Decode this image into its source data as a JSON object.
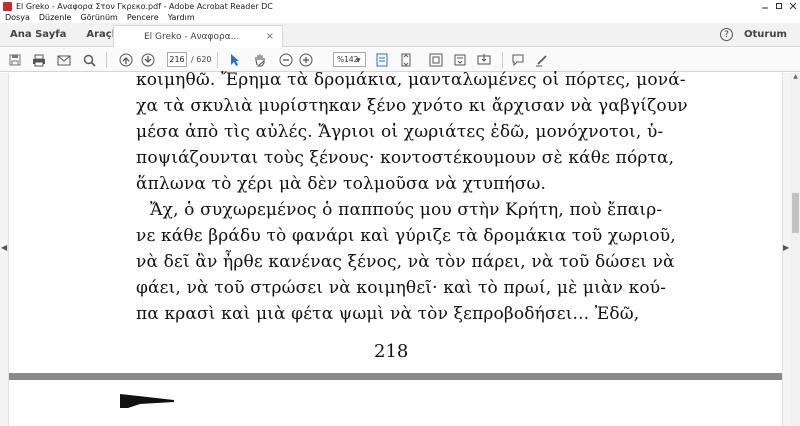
{
  "window": {
    "title": "El Greko - Αναφορα Στον Γκρεκο.pdf - Adobe Acrobat Reader DC",
    "controls": [
      "minimize-icon",
      "maximize-icon",
      "close-icon"
    ]
  },
  "menu": [
    "Dosya",
    "Düzenle",
    "Görünüm",
    "Pencere",
    "Yardım"
  ],
  "tabs": {
    "home": "Ana Sayfa",
    "tools": "Araçlar",
    "document": "El Greko - Αναφορα...",
    "document_close": "×",
    "help": "?",
    "signin": "Oturum Aç"
  },
  "toolbar": {
    "current_page": "216",
    "total_pages": "/ 620",
    "zoom": "%142",
    "icons": [
      "save-icon",
      "print-icon",
      "email-icon",
      "search-icon",
      "prev-page-icon",
      "next-page-icon",
      "select-cursor-icon",
      "hand-icon",
      "zoom-out-icon",
      "zoom-in-icon",
      "fit-page-icon",
      "scroll-mode-icon",
      "read-mode-icon",
      "rotate-icon",
      "export-icon",
      "comment-icon",
      "sign-icon"
    ]
  },
  "document": {
    "lines": [
      "κοιμηθῶ. Ἔρημα τὰ δρομάκια, μανταλωμένες οἱ πόρτες, μονά-",
      "χα τὰ σκυλιὰ μυρίστηκαν ξένο χνότο κι ἄρχισαν νὰ γαβγίζουν",
      "μέσα ἀπὸ τὶς αὐλές. Ἄγριοι οἱ χωριάτες ἐδῶ, μονόχνοτοι, ὑ-",
      "ποψιάζουνται τοὺς ξένους· κοντοστέκουμουν σὲ κάθε πόρτα,",
      "ἅπλωνα τὸ χέρι μὰ δὲν τολμοῦσα νὰ χτυπήσω.",
      "Ἄχ, ὁ συχωρεμένος ὁ παππούς μου στὴν Κρήτη, ποὺ ἔπαιρ-",
      "νε κάθε βράδυ τὸ φανάρι καὶ γύριζε τὰ δρομάκια τοῦ χωριοῦ,",
      "νὰ δεῖ ἂν ἦρθε κανένας ξένος, νὰ τὸν πάρει, νὰ τοῦ δώσει νὰ",
      "φάει, νὰ τοῦ στρώσει νὰ κοιμηθεῖ· καὶ τὸ πρωί, μὲ μιὰν κού-",
      "πα κρασὶ καὶ μιὰ φέτα ψωμὶ νὰ τὸν ξεπροβοδήσει... Ἐδῶ,"
    ],
    "page_number": "218"
  }
}
